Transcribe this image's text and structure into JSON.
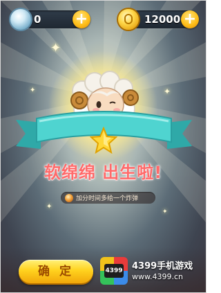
{
  "currency": {
    "gems_value": "0",
    "coins_value": "12000",
    "gem_icon": "diamond-icon",
    "coin_icon": "coin-icon"
  },
  "popup": {
    "title": "软绵绵  出生啦!",
    "hint": "加分时间多给一个炸弹",
    "confirm_label": "确 定"
  },
  "watermark": {
    "logo_text": "4399",
    "title": "4399手机游戏",
    "url": "www.4399.cn"
  },
  "colors": {
    "ribbon": "#4fd4d0",
    "title_text": "#ff6a6a",
    "button": "#ffd21e"
  }
}
